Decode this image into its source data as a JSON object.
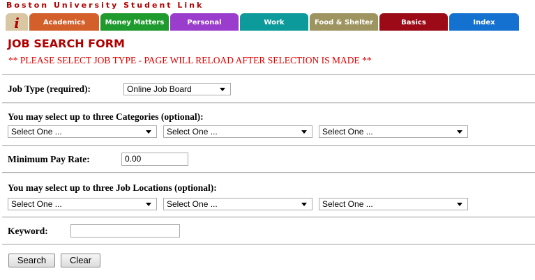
{
  "header": {
    "site_title": "Boston University Student Link",
    "tabs": [
      {
        "label": "i",
        "color": "#d9c7a3",
        "icon": "info-icon"
      },
      {
        "label": "Academics",
        "color": "#d35f2a"
      },
      {
        "label": "Money Matters",
        "color": "#1e9a2e"
      },
      {
        "label": "Personal",
        "color": "#9b3dcc"
      },
      {
        "label": "Work",
        "color": "#0d9a9a"
      },
      {
        "label": "Food & Shelter",
        "color": "#9d9460"
      },
      {
        "label": "Basics",
        "color": "#9b0a16"
      },
      {
        "label": "Index",
        "color": "#1471cf"
      }
    ]
  },
  "form": {
    "title": "JOB SEARCH FORM",
    "notice": "** PLEASE SELECT JOB TYPE - PAGE WILL RELOAD AFTER SELECTION IS MADE **",
    "job_type": {
      "label": "Job Type (required):",
      "value": "Online Job Board"
    },
    "categories": {
      "label": "You may select up to three Categories (optional):",
      "selects": [
        "Select One ...",
        "Select One ...",
        "Select One ..."
      ]
    },
    "min_pay": {
      "label": "Minimum Pay Rate:",
      "value": "0.00"
    },
    "locations": {
      "label": "You may select up to three Job Locations (optional):",
      "selects": [
        "Select One ...",
        "Select One ...",
        "Select One ..."
      ]
    },
    "keyword": {
      "label": "Keyword:",
      "value": ""
    },
    "buttons": {
      "search": "Search",
      "clear": "Clear"
    }
  }
}
